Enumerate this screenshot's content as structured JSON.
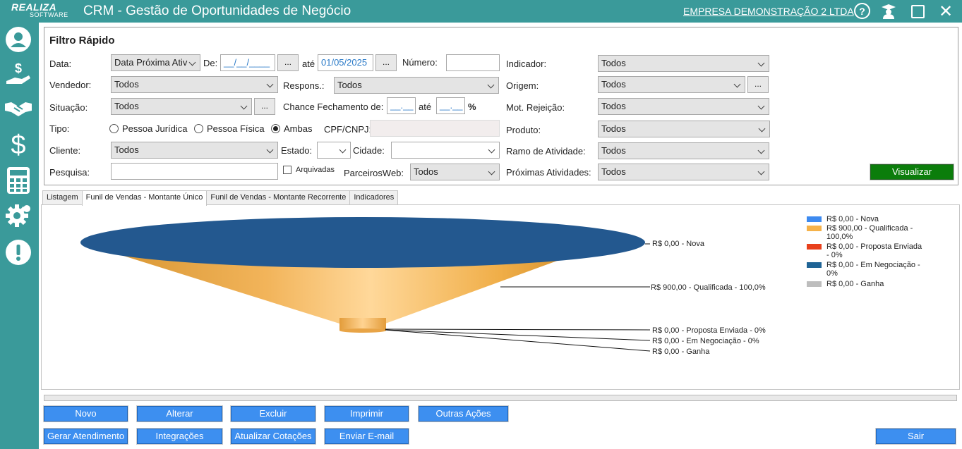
{
  "app": {
    "logo_text": "REALIZA",
    "logo_subtext": "SOFTWARE",
    "title": "CRM - Gestão de Oportunidades de Negócio",
    "company": "EMPRESA DEMONSTRAÇÃO 2 LTDA",
    "help_glyph": "?",
    "close_glyph": "✕"
  },
  "sidebar": {
    "items": [
      "user-icon",
      "hand-money-icon",
      "handshake-icon",
      "dollar-icon",
      "calculator-icon",
      "gear-icon",
      "alert-icon"
    ]
  },
  "filter": {
    "title": "Filtro Rápido",
    "data_label": "Data:",
    "data_select": "Data Próxima Ativ",
    "de_label": "De:",
    "de_value": "__/__/____",
    "ate_label": "até",
    "ate_value": "01/05/2025",
    "dots": "...",
    "numero_label": "Número:",
    "numero_value": "",
    "indicador_label": "Indicador:",
    "indicador_value": "Todos",
    "vendedor_label": "Vendedor:",
    "vendedor_value": "Todos",
    "respons_label": "Respons.:",
    "respons_value": "Todos",
    "origem_label": "Origem:",
    "origem_value": "Todos",
    "situacao_label": "Situação:",
    "situacao_value": "Todos",
    "chance_label": "Chance Fechamento de:",
    "chance_de": "__.__",
    "chance_ate_label": "até",
    "chance_ate": "__.__",
    "percent": "%",
    "mot_rejeicao_label": "Mot. Rejeição:",
    "mot_rejeicao_value": "Todos",
    "tipo_label": "Tipo:",
    "tipo_options": [
      "Pessoa Jurídica",
      "Pessoa Física",
      "Ambas"
    ],
    "tipo_selected": "Ambas",
    "cpf_label": "CPF/CNPJ:",
    "produto_label": "Produto:",
    "produto_value": "Todos",
    "cliente_label": "Cliente:",
    "cliente_value": "Todos",
    "estado_label": "Estado:",
    "estado_value": "",
    "cidade_label": "Cidade:",
    "cidade_value": "",
    "ramo_label": "Ramo de Atividade:",
    "ramo_value": "Todos",
    "pesquisa_label": "Pesquisa:",
    "pesquisa_value": "",
    "arquivadas_label": "Arquivadas",
    "parceiros_label": "ParceirosWeb:",
    "parceiros_value": "Todos",
    "proximas_label": "Próximas Atividades:",
    "proximas_value": "Todos",
    "visualizar_label": "Visualizar"
  },
  "tabs": [
    "Listagem",
    "Funil de Vendas - Montante Único",
    "Funil de Vendas - Montante Recorrente",
    "Indicadores"
  ],
  "active_tab": 1,
  "chart_data": {
    "type": "funnel",
    "title": "",
    "stages": [
      {
        "name": "Nova",
        "value": 0,
        "label": "R$ 0,00 - Nova",
        "legend": "R$ 0,00 - Nova",
        "color": "#3d8af0"
      },
      {
        "name": "Qualificada",
        "value": 900,
        "percent": 100.0,
        "label": "R$ 900,00 - Qualificada - 100,0%",
        "legend": "R$ 900,00 - Qualificada - 100,0%",
        "color": "#f5b24a"
      },
      {
        "name": "Proposta Enviada",
        "value": 0,
        "percent": 0,
        "label": "R$ 0,00 - Proposta Enviada - 0%",
        "legend": "R$ 0,00 - Proposta Enviada - 0%",
        "color": "#e8401c"
      },
      {
        "name": "Em Negociação",
        "value": 0,
        "percent": 0,
        "label": "R$ 0,00 - Em Negociação - 0%",
        "legend": "R$ 0,00 - Em Negociação - 0%",
        "color": "#1f6496"
      },
      {
        "name": "Ganha",
        "value": 0,
        "label": "R$ 0,00 - Ganha",
        "legend": "R$ 0,00 - Ganha",
        "color": "#bdbdbd"
      }
    ],
    "top_color": "#23588f"
  },
  "buttons": {
    "novo": "Novo",
    "alterar": "Alterar",
    "excluir": "Excluir",
    "imprimir": "Imprimir",
    "outras": "Outras Ações",
    "gerar": "Gerar Atendimento",
    "integracoes": "Integrações",
    "atualizar": "Atualizar Cotações",
    "enviar": "Enviar E-mail",
    "sair": "Sair"
  }
}
